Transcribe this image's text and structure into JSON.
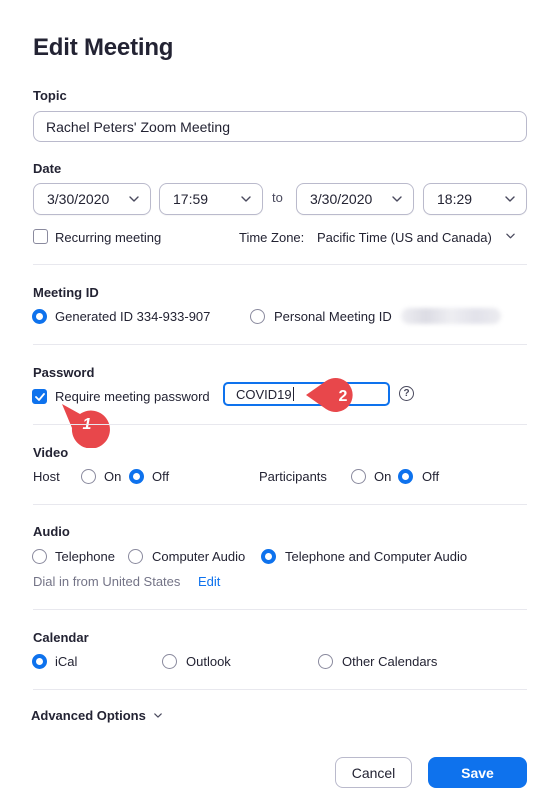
{
  "dialog": {
    "title": "Edit Meeting"
  },
  "topic": {
    "label": "Topic",
    "value": "Rachel Peters' Zoom Meeting"
  },
  "date": {
    "label": "Date",
    "start_date": "3/30/2020",
    "start_time": "17:59",
    "to_label": "to",
    "end_date": "3/30/2020",
    "end_time": "18:29",
    "recurring_label": "Recurring meeting",
    "recurring_checked": false,
    "timezone_label": "Time Zone:",
    "timezone_value": "Pacific Time (US and Canada)"
  },
  "meeting_id": {
    "label": "Meeting ID",
    "generated_label": "Generated ID 334-933-907",
    "personal_label": "Personal Meeting ID",
    "selected": "generated"
  },
  "password": {
    "label": "Password",
    "require_label": "Require meeting password",
    "require_checked": true,
    "value": "COVID19",
    "help_glyph": "?"
  },
  "video": {
    "label": "Video",
    "host_label": "Host",
    "participants_label": "Participants",
    "on_label": "On",
    "off_label": "Off",
    "host_selected": "off",
    "participants_selected": "off"
  },
  "audio": {
    "label": "Audio",
    "options": [
      "Telephone",
      "Computer Audio",
      "Telephone and Computer Audio"
    ],
    "selected": "Telephone and Computer Audio",
    "dial_in_text": "Dial in from United States",
    "edit_label": "Edit"
  },
  "calendar": {
    "label": "Calendar",
    "options": [
      "iCal",
      "Outlook",
      "Other Calendars"
    ],
    "selected": "iCal"
  },
  "advanced": {
    "label": "Advanced Options"
  },
  "buttons": {
    "cancel": "Cancel",
    "save": "Save"
  },
  "annotations": {
    "marker_1": "1",
    "marker_2": "2",
    "marker_color": "#e8474b"
  },
  "colors": {
    "accent": "#0e72ed",
    "text": "#232333",
    "muted": "#747487"
  }
}
